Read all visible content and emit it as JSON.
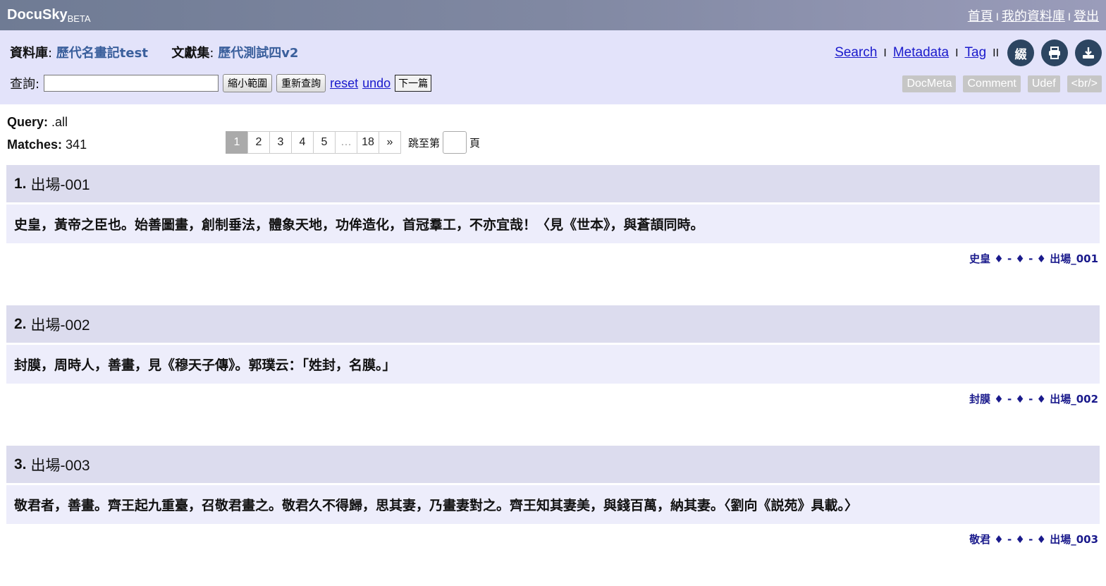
{
  "header": {
    "logo": "DocuSky",
    "logo_sub": "BETA",
    "links": [
      "首頁",
      "我的資料庫",
      "登出"
    ]
  },
  "panel": {
    "db_label": "資料庫",
    "db_value": "歷代名畫記test",
    "corpus_label": "文獻集",
    "corpus_value": "歷代測試四v2",
    "query_label": "查詢:",
    "query_value": "",
    "btn_narrow": "縮小範圍",
    "btn_requery": "重新查詢",
    "link_reset": "reset",
    "link_undo": "undo",
    "btn_next": "下一篇",
    "nav": [
      "Search",
      "Metadata",
      "Tag"
    ],
    "icon_buttons": [
      "綴",
      "print-icon",
      "download-icon"
    ],
    "tags": [
      "DocMeta",
      "Comment",
      "Udef",
      "<br/>"
    ]
  },
  "info": {
    "query_label": "Query:",
    "query_value": ".all",
    "matches_label": "Matches:",
    "matches_value": "341"
  },
  "pager": {
    "pages": [
      "1",
      "2",
      "3",
      "4",
      "5",
      "…",
      "18",
      "»"
    ],
    "jump_prefix": "跳至第",
    "jump_suffix": "頁"
  },
  "docs": [
    {
      "num": "1.",
      "title": "出場-001",
      "text": "史皇，黃帝之臣也。始善圖畫，創制垂法，體象天地，功侔造化，首冠羣工，不亦宜哉！〈見《世本》，與蒼頡同時。",
      "meta": "史皇 ♦ - ♦ - ♦ 出場_001"
    },
    {
      "num": "2.",
      "title": "出場-002",
      "text": "封膜，周時人，善畫，見《穆天子傳》。郭璞云：「姓封，名膜。」",
      "meta": "封膜 ♦ - ♦ - ♦ 出場_002"
    },
    {
      "num": "3.",
      "title": "出場-003",
      "text": "敬君者，善畫。齊王起九重臺，召敬君畫之。敬君久不得歸，思其妻，乃畫妻對之。齊王知其妻美，與錢百萬，納其妻。〈劉向《説苑》具載。〉",
      "meta": "敬君 ♦ - ♦ - ♦ 出場_003"
    }
  ]
}
